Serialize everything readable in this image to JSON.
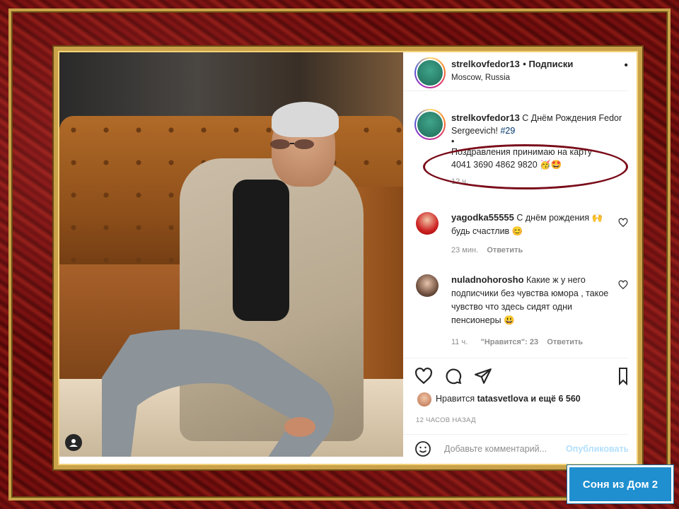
{
  "post": {
    "username": "strelkovfedor13",
    "follow_label": "• Подписки",
    "location": "Moscow, Russia",
    "more_label": "•"
  },
  "caption": {
    "username": "strelkovfedor13",
    "text_1": " С Днём Рождения Fedor Sergeevich! ",
    "hashtag": "#29",
    "bullet": "•",
    "text_2": "Поздравления принимаю на карту",
    "card": "4041 3690 4862 9820 🥳🤩",
    "age": "12 ч."
  },
  "comments": [
    {
      "username": "yagodka55555",
      "text": " С днём рождения 🙌 будь счастлив 😊",
      "age": "23 мин.",
      "reply_label": "Ответить"
    },
    {
      "username": "nuladnohorosho",
      "text": " Какие ж у него подписчики без чувства юмора , такое чувство что здесь сидят одни пенсионеры 😃",
      "age": "11 ч.",
      "likes": "\"Нравится\": 23",
      "reply_label": "Ответить"
    }
  ],
  "likes": {
    "prefix": "Нравится ",
    "user": "tatasvetlova",
    "suffix": " и ещё 6 560"
  },
  "timestamp": "12 ЧАСОВ НАЗАД",
  "add_comment": {
    "placeholder": "Добавьте комментарий...",
    "publish_label": "Опубликовать"
  },
  "badge": "Соня из Дом 2",
  "colors": {
    "frame": "#7a1010",
    "gold": "#c9a24a",
    "oval": "#7a0c1a",
    "link": "#00376b",
    "publish": "#b2dffc",
    "badge": "#1f8fd0"
  }
}
